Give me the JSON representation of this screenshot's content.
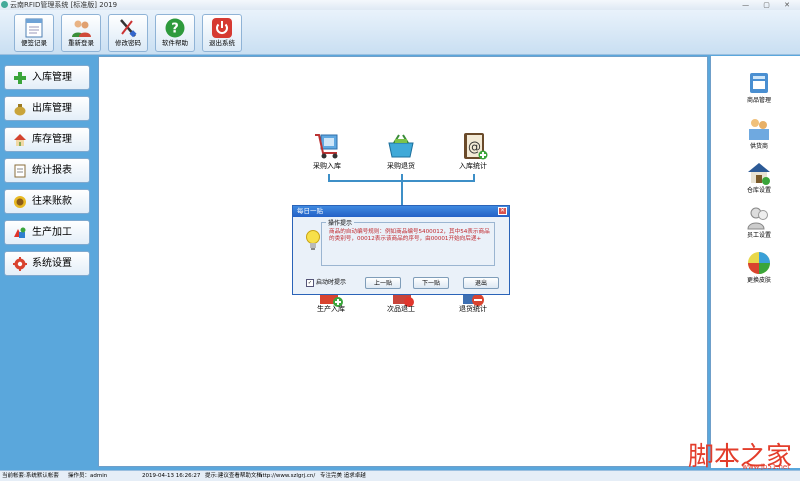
{
  "window": {
    "title": "云南RFID管理系统 [标准版] 2019"
  },
  "toolbar": [
    {
      "label": "便签记录",
      "icon": "notepad-icon"
    },
    {
      "label": "重新登录",
      "icon": "users-icon"
    },
    {
      "label": "修改密码",
      "icon": "edit-tools-icon"
    },
    {
      "label": "软件帮助",
      "icon": "help-icon"
    },
    {
      "label": "退出系统",
      "icon": "power-icon"
    }
  ],
  "leftnav": [
    {
      "label": "入库管理",
      "icon": "plus-icon"
    },
    {
      "label": "出库管理",
      "icon": "money-bag-icon"
    },
    {
      "label": "库存管理",
      "icon": "house-icon"
    },
    {
      "label": "统计报表",
      "icon": "report-icon"
    },
    {
      "label": "往来账款",
      "icon": "coins-icon"
    },
    {
      "label": "生产加工",
      "icon": "shapes-icon"
    },
    {
      "label": "系统设置",
      "icon": "gear-icon"
    }
  ],
  "flow": {
    "top": [
      {
        "label": "采购入库",
        "icon": "cart-icon"
      },
      {
        "label": "采购退货",
        "icon": "basket-icon"
      },
      {
        "label": "入库统计",
        "icon": "address-book-icon"
      }
    ],
    "bottom": [
      {
        "label": "生产入库",
        "icon": "production-icon"
      },
      {
        "label": "次品退工",
        "icon": "defect-icon"
      },
      {
        "label": "退货统计",
        "icon": "return-stats-icon"
      }
    ]
  },
  "dialog": {
    "title": "每日一贴",
    "group_label": "操作提示",
    "tip": "商品的自动编号规则：例如商品编号5400012，其中54表示商品的类别号，00012表示该商品的序号，由00001开始向后递+",
    "checkbox_label": "启动时提示",
    "checkbox_checked": true,
    "prev_label": "上一贴",
    "next_label": "下一贴",
    "exit_label": "退出"
  },
  "rightpanel": [
    {
      "label": "商品管理",
      "icon": "product-icon"
    },
    {
      "label": "供货商",
      "icon": "supplier-icon"
    },
    {
      "label": "仓库设置",
      "icon": "warehouse-icon"
    },
    {
      "label": "员工设置",
      "icon": "staff-icon"
    },
    {
      "label": "更换皮肤",
      "icon": "palette-icon"
    }
  ],
  "statusbar": {
    "account": "当前帐套:系统默认帐套",
    "operator": "操作员：admin",
    "datetime": "2019-04-13 16:26:27",
    "help": "提示:建议查看帮助文档",
    "url": "http://www.szlgrj.cn/",
    "slogan": "专注完美 追求卓越"
  },
  "watermark": {
    "main": "脚本之家",
    "sub": "www.jb51.net"
  },
  "colors": {
    "accent": "#5aa7dc",
    "tip_text": "#c0282d",
    "titlebar": "#2360c6"
  }
}
